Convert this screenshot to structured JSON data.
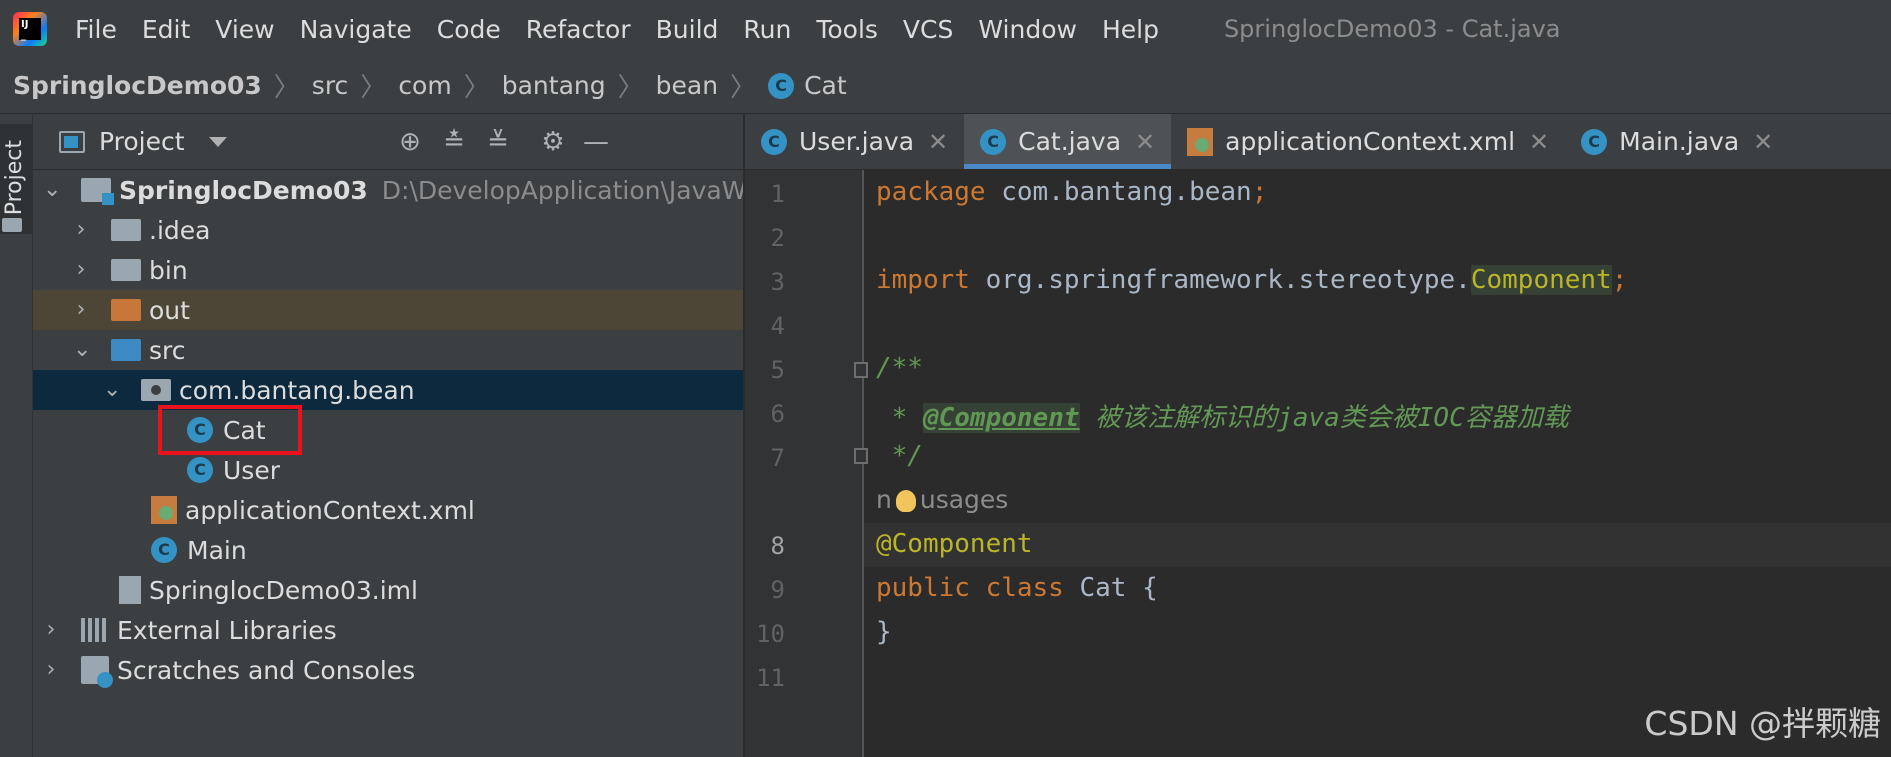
{
  "menubar": {
    "items": [
      "File",
      "Edit",
      "View",
      "Navigate",
      "Code",
      "Refactor",
      "Build",
      "Run",
      "Tools",
      "VCS",
      "Window",
      "Help"
    ],
    "window_title": "SpringlocDemo03 - Cat.java"
  },
  "breadcrumb": {
    "items": [
      "SpringlocDemo03",
      "src",
      "com",
      "bantang",
      "bean",
      "Cat"
    ]
  },
  "project_panel": {
    "title": "Project",
    "strip_label": "Project"
  },
  "tree": {
    "root_name": "SpringlocDemo03",
    "root_path": "D:\\DevelopApplication\\JavaWorkSp",
    "idea": ".idea",
    "bin": "bin",
    "out": "out",
    "src": "src",
    "package": "com.bantang.bean",
    "cat": "Cat",
    "user": "User",
    "app_ctx": "applicationContext.xml",
    "main": "Main",
    "iml": "SpringlocDemo03.iml",
    "ext_libs": "External Libraries",
    "scratches": "Scratches and Consoles"
  },
  "tabs": [
    {
      "label": "User.java"
    },
    {
      "label": "Cat.java",
      "active": true
    },
    {
      "label": "applicationContext.xml"
    },
    {
      "label": "Main.java"
    }
  ],
  "editor": {
    "line_numbers": [
      "1",
      "2",
      "3",
      "4",
      "5",
      "6",
      "7",
      "8",
      "9",
      "10",
      "11"
    ],
    "current_line": "8",
    "l1_kw": "package",
    "l1_rest": " com.bantang.bean",
    "l1_semi": ";",
    "l3_kw": "import",
    "l3_rest": " org.springframework.stereotype.",
    "l3_ann": "Component",
    "l3_semi": ";",
    "l5": "/**",
    "l6_star": " * ",
    "l6_tag": "@Component",
    "l6_text": " 被该注解标识的java类会被IOC容器加载",
    "l7": " */",
    "usages_pre": "n",
    "usages_post": "usages",
    "l8": "@Component",
    "l9_kw": "public class",
    "l9_rest": " Cat {",
    "l10": "}"
  },
  "watermark": "CSDN @拌颗糖",
  "colors": {
    "keyword": "#cc7832",
    "annotation": "#bbb529",
    "comment": "#629755",
    "selection": "#0d293e",
    "highlight_box": "#e8131c"
  }
}
